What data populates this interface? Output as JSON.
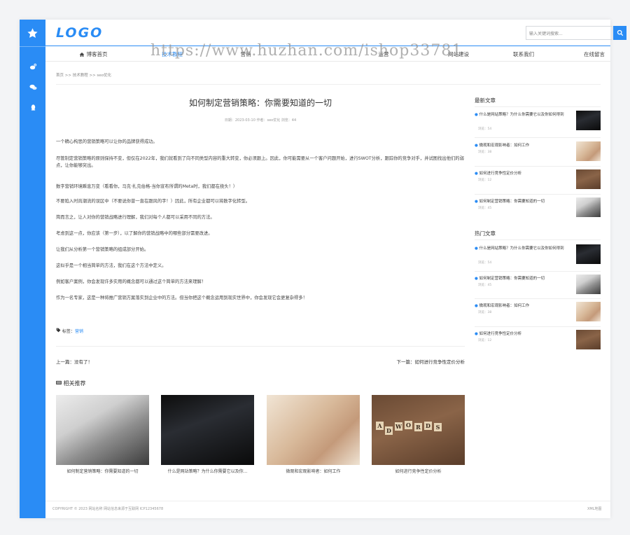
{
  "colors": {
    "accent": "#2a8cf5"
  },
  "header": {
    "logo": "LOGO",
    "search_placeholder": "输入关键词搜索..."
  },
  "nav": {
    "items": [
      "博客首页",
      "技术教程",
      "营销",
      "运营",
      "网站建设",
      "联系我们",
      "在线留言"
    ]
  },
  "watermark": "https://www.huzhan.com/ishop33781",
  "breadcrumb": "首页 >> 技术教程 >> seo优化",
  "article": {
    "title": "如何制定营销策略：你需要知道的一切",
    "meta": "日期：2023-03-10    作者：seo优化    浏览：44",
    "paragraphs": [
      "一个精心构思的营销策略可以让你的品牌获得成功。",
      "尽管制定营销策略的原则保持不变，但仅在2022年，我们就看到了向不同类型内容的重大转变，你必须跟上。因此，你可能需要从一个客户问题开始，进行SWOT分析，跟踪你的竞争对手，并试图找出他们的弱点，让你能够突出。",
      "数字营销环境瞬息万变（看看你，马克·扎克伯格-当你宣布所谓的Meta时，我们都在挠头！）",
      "不要陷入时尚潮流的误区中（不要说你曾一直在跟风的字！）因此，所有企业都可以将数字化转型。",
      "简而言之，让人对你的营销战略进行理解，我们对每个人都可以采用不同的方法。",
      "考虑到这一点，你应该（第一步），以了解你的营销战略中的哪些部分需要改进。",
      "让我们从分析第一个营销策略的组成部分开始。",
      "这似乎是一个相当简单的方法，我们在这个方法中定义。",
      "例如客户案例，你会发现许多实用的概念都可以通过这个简单的方法来理解！",
      "作为一名专家，这是一种将推广营销方案落实到企业中的方法。但当你把这个概念运用到现实世界中，你会发现它会更复杂得多！"
    ],
    "tag_label": "标签：",
    "tag": "营销",
    "prev": "上一篇：没有了！",
    "next": "下一篇：如何进行竞争性定价分析"
  },
  "related": {
    "title": "相关推荐",
    "items": [
      {
        "caption": "如何制定营销策略：你需要知道的一切",
        "image": "laptop-photo"
      },
      {
        "caption": "什么是网站策略？为什么你需要它以及你...",
        "image": "sports-car-photo"
      },
      {
        "caption": "微观和宏观影响者：如何工作",
        "image": "handshake-city-photo"
      },
      {
        "caption": "如何进行竞争性定价分析",
        "image": "scrabble-adwords-photo"
      }
    ]
  },
  "sidebar": {
    "latest_title": "最新文章",
    "latest": [
      {
        "title": "什么是网站策略？为什么你需要它以及你如何得到",
        "views": "浏览：54",
        "image": "sports-car-photo"
      },
      {
        "title": "微观和宏观影响者：如何工作",
        "views": "浏览：38",
        "image": "handshake-city-photo"
      },
      {
        "title": "如何进行竞争性定价分析",
        "views": "浏览：12",
        "image": "scrabble-adwords-photo"
      },
      {
        "title": "如何制定营销策略：你需要知道的一切",
        "views": "浏览：45",
        "image": "laptop-photo"
      }
    ],
    "hot_title": "热门文章",
    "hot": [
      {
        "title": "什么是网站策略？为什么你需要它以及你如何得到",
        "views": "浏览：54",
        "image": "sports-car-photo"
      },
      {
        "title": "如何制定营销策略：你需要知道的一切",
        "views": "浏览：45",
        "image": "laptop-photo"
      },
      {
        "title": "微观和宏观影响者：如何工作",
        "views": "浏览：38",
        "image": "handshake-city-photo"
      },
      {
        "title": "如何进行竞争性定价分析",
        "views": "浏览：12",
        "image": "scrabble-adwords-photo"
      }
    ]
  },
  "footer": {
    "copyright": "COPYRIGHT © 2023 网站名称 网站信息来源于互联网 ICP12345678",
    "sitemap": "XML地图"
  }
}
